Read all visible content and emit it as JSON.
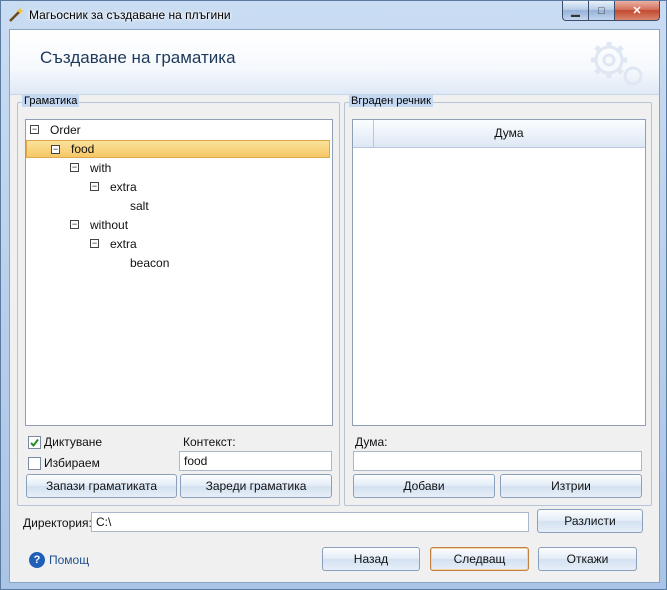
{
  "window": {
    "title": "Магьосник за създаване на плъгини"
  },
  "header": {
    "title": "Създаване на граматика"
  },
  "grammar": {
    "group_title": "Граматика",
    "tree": [
      {
        "label": "Order",
        "level": 0,
        "expanded": true,
        "selected": false
      },
      {
        "label": "food",
        "level": 1,
        "expanded": true,
        "selected": true
      },
      {
        "label": "with",
        "level": 2,
        "expanded": true,
        "selected": false
      },
      {
        "label": "extra",
        "level": 3,
        "expanded": true,
        "selected": false
      },
      {
        "label": "salt",
        "level": 4,
        "expanded": null,
        "selected": false
      },
      {
        "label": "without",
        "level": 2,
        "expanded": true,
        "selected": false
      },
      {
        "label": "extra",
        "level": 3,
        "expanded": true,
        "selected": false
      },
      {
        "label": "beacon",
        "level": 4,
        "expanded": null,
        "selected": false
      }
    ],
    "dictation_label": "Диктуване",
    "dictation_checked": true,
    "choose_label": "Избираем",
    "choose_checked": false,
    "context_label": "Контекст:",
    "context_value": "food",
    "save_button": "Запази граматиката",
    "load_button": "Зареди граматика"
  },
  "dictionary": {
    "group_title": "Вграден речник",
    "column_header": "Дума",
    "word_label": "Дума:",
    "word_value": "",
    "add_button": "Добави",
    "delete_button": "Изтрии"
  },
  "directory": {
    "label": "Директория:",
    "value": "C:\\",
    "browse_button": "Разлисти"
  },
  "footer": {
    "help_label": "Помощ",
    "back_button": "Назад",
    "next_button": "Следващ",
    "cancel_button": "Откажи"
  },
  "colors": {
    "selection": "#f6c866",
    "header_title": "#1e395b",
    "help_icon": "#1f5fb8"
  }
}
